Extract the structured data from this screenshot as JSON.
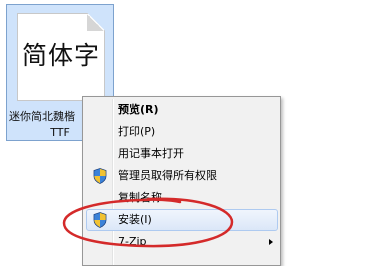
{
  "file": {
    "preview_text": "简体字",
    "name": "迷你简北魏楷",
    "extension": "TTF"
  },
  "context_menu": {
    "items": [
      {
        "label": "预览(R)",
        "icon": "none",
        "default": true
      },
      {
        "label": "打印(P)",
        "icon": "none"
      },
      {
        "label": "用记事本打开",
        "icon": "none"
      },
      {
        "label": "管理员取得所有权限",
        "icon": "uac-shield-icon"
      },
      {
        "label": "复制名称",
        "icon": "none"
      },
      {
        "label": "安装(I)",
        "icon": "uac-shield-icon",
        "hovered": true
      },
      {
        "label": "7-Zip",
        "icon": "none",
        "submenu": true
      }
    ]
  },
  "colors": {
    "selection_fill": "#cfe3fb",
    "selection_border": "#7da2ce",
    "menu_background": "#f1f1f1",
    "annotation_red": "#d42a2a"
  }
}
